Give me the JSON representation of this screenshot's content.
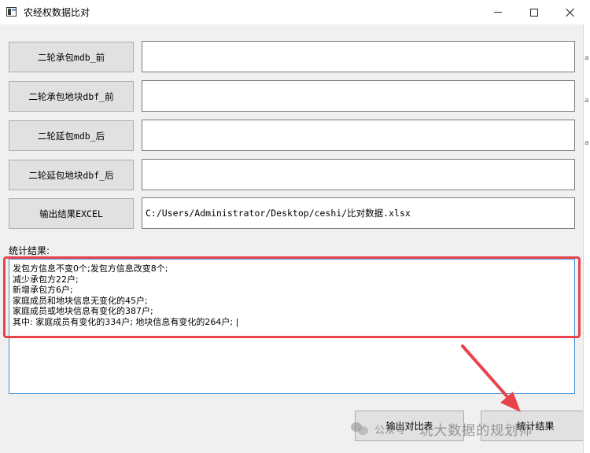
{
  "window": {
    "title": "农经权数据比对"
  },
  "files": [
    {
      "button_label": "二轮承包mdb_前",
      "value": ""
    },
    {
      "button_label": "二轮承包地块dbf_前",
      "value": ""
    },
    {
      "button_label": "二轮延包mdb_后",
      "value": ""
    },
    {
      "button_label": "二轮延包地块dbf_后",
      "value": ""
    },
    {
      "button_label": "输出结果EXCEL",
      "value": "C:/Users/Administrator/Desktop/ceshi/比对数据.xlsx"
    }
  ],
  "results": {
    "label": "统计结果:",
    "lines": [
      "发包方信息不变0个;发包方信息改变8个;",
      "减少承包方22户;",
      "新增承包方6户;",
      "家庭成员和地块信息无变化的45户;",
      "家庭成员或地块信息有变化的387户;",
      "其中: 家庭成员有变化的334户; 地块信息有变化的264户; |"
    ]
  },
  "actions": {
    "export_label": "输出对比表",
    "stats_label": "统计结果"
  },
  "watermark": {
    "prefix": "公众号 ·",
    "name": "玩大数据的规划师"
  },
  "colors": {
    "highlight": "#e8434b",
    "focus_border": "#3c8ed8",
    "button_bg": "#e1e1e1"
  }
}
